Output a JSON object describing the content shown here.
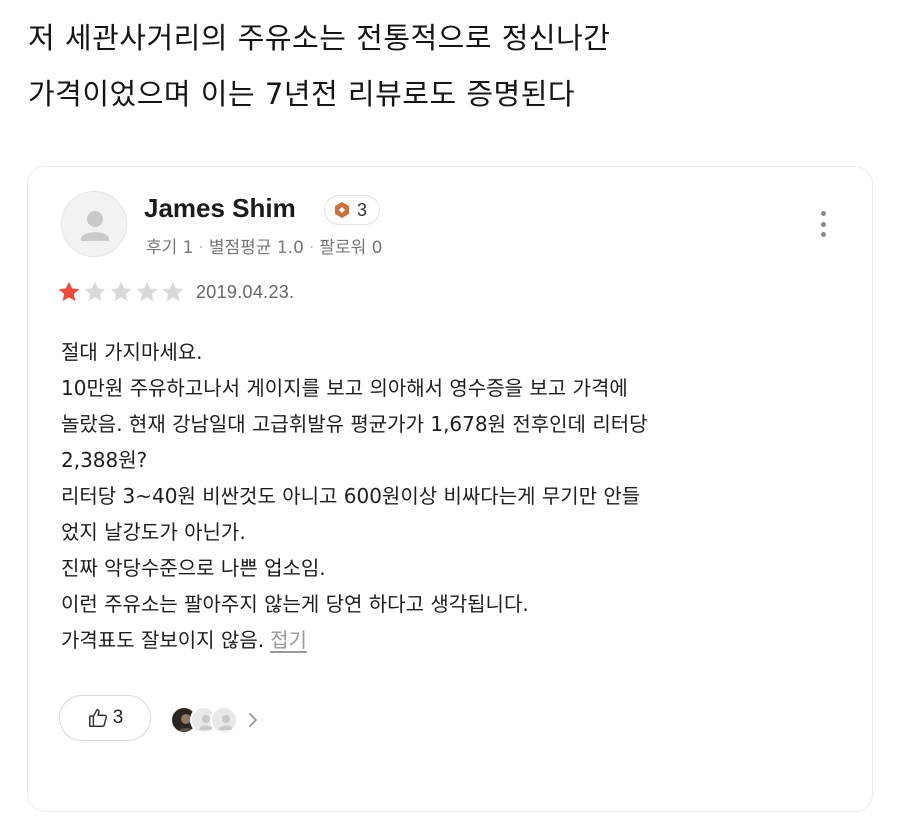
{
  "headline": {
    "line1": "저 세관사거리의 주유소는 전통적으로 정신나간",
    "line2": "가격이었으며 이는 7년전 리뷰로도 증명된다"
  },
  "review": {
    "author_name": "James Shim",
    "level": "3",
    "meta": {
      "review_count": "후기 1",
      "avg_rating": "별점평균 1.0",
      "followers": "팔로워 0"
    },
    "rating": 1,
    "rating_max": 5,
    "date": "2019.04.23.",
    "body_lines": [
      "절대 가지마세요.",
      "10만원 주유하고나서 게이지를 보고 의아해서 영수증을 보고 가격에",
      "놀랐음. 현재 강남일대 고급휘발유 평균가가 1,678원 전후인데 리터당",
      " 2,388원?",
      "리터당 3~40원 비싼것도 아니고 600원이상 비싸다는게 무기만 안들",
      "었지 날강도가 아닌가.",
      "진짜 악당수준으로 나쁜 업소임.",
      "이런 주유소는 팔아주지 않는게 당연 하다고 생각됩니다."
    ],
    "last_line": "가격표도 잘보이지 않음.",
    "fold_label": "접기",
    "like_count": "3"
  },
  "colors": {
    "star_filled": "#f04a3c",
    "star_empty": "#d9d9d9",
    "level_badge": "#c8743a"
  },
  "icons": {
    "avatar": "person-placeholder-icon",
    "level": "level-badge-icon",
    "more": "more-vertical-icon",
    "like": "thumbs-up-icon",
    "chevron": "chevron-right-icon"
  }
}
